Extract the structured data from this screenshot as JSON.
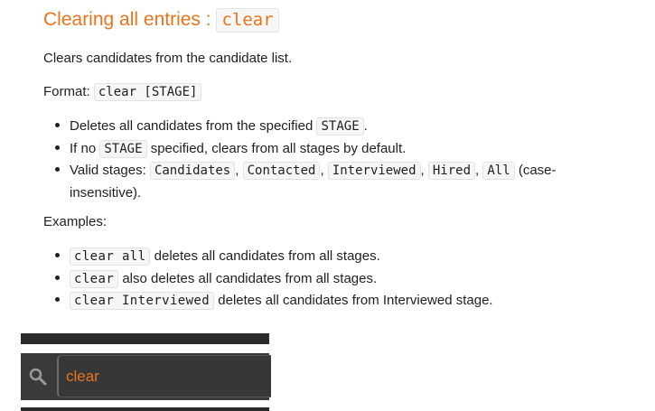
{
  "section": {
    "title_prefix": "Clearing all entries :",
    "title_code": "clear"
  },
  "description": "Clears candidates from the candidate list.",
  "format": {
    "label": "Format:",
    "code": "clear [STAGE]"
  },
  "notes": [
    {
      "pre": "Deletes all candidates from the specified",
      "code": "STAGE",
      "post": "."
    },
    {
      "pre": "If no",
      "code": "STAGE",
      "post": "specified, clears from all stages by default."
    }
  ],
  "valid_stages": {
    "label": "Valid stages:",
    "stages": [
      "Candidates",
      "Contacted",
      "Interviewed",
      "Hired",
      "All"
    ],
    "suffix_1": "(case-",
    "suffix_2": "insensitive)."
  },
  "examples_label": "Examples:",
  "examples": [
    {
      "code": "clear all",
      "text": "deletes all candidates from all stages."
    },
    {
      "code": "clear",
      "text": "also deletes all candidates from all stages."
    },
    {
      "code": "clear Interviewed",
      "text": "deletes all candidates from Interviewed stage."
    }
  ],
  "command_box": {
    "value": "clear",
    "icon": "search-icon",
    "accent_color": "#e8741c",
    "bg_color": "#3a3a3a"
  }
}
